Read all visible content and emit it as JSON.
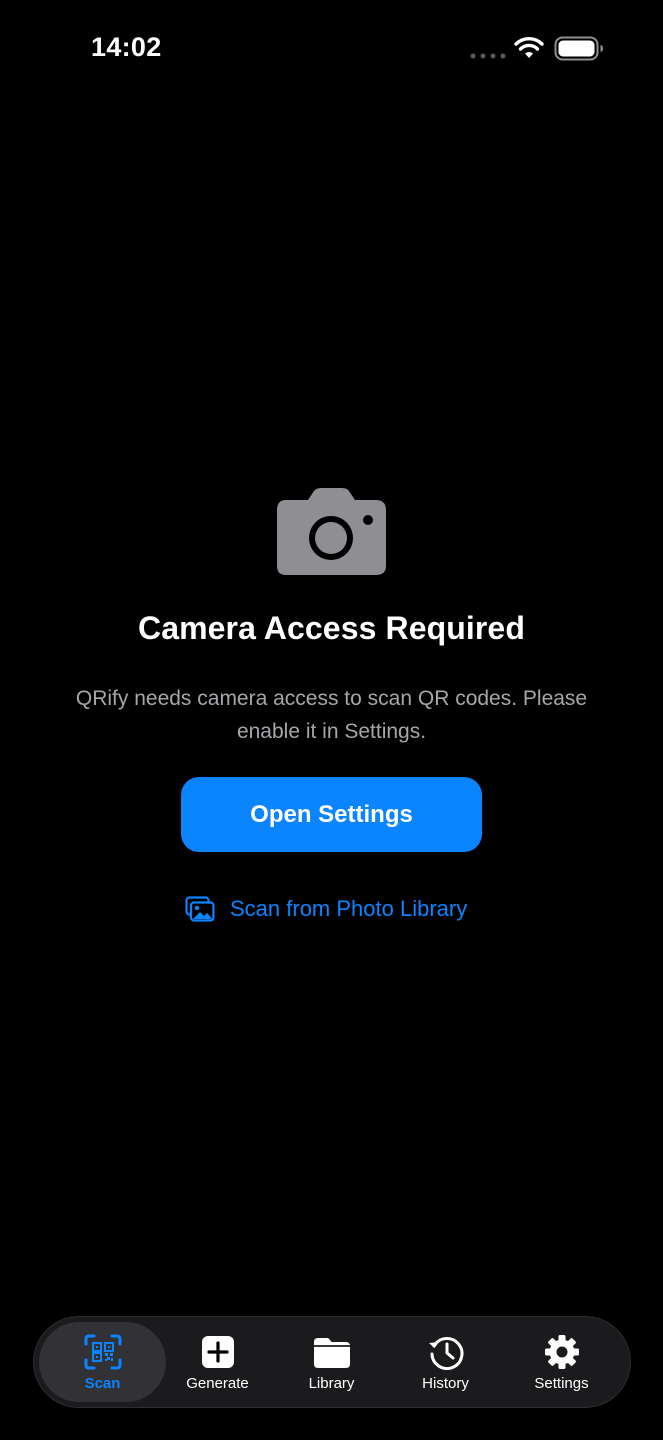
{
  "status_bar": {
    "time": "14:02"
  },
  "permission": {
    "title": "Camera Access Required",
    "message": "QRify needs camera access to scan QR codes. Please enable it in Settings.",
    "primary_button": "Open Settings",
    "secondary_link": "Scan from Photo Library"
  },
  "tab_bar": {
    "active": "Scan",
    "tabs": [
      {
        "label": "Scan",
        "icon": "qr-scan-icon"
      },
      {
        "label": "Generate",
        "icon": "plus-square-icon"
      },
      {
        "label": "Library",
        "icon": "folder-icon"
      },
      {
        "label": "History",
        "icon": "history-clock-icon"
      },
      {
        "label": "Settings",
        "icon": "gear-icon"
      }
    ]
  },
  "colors": {
    "background": "#000000",
    "accent": "#0a84ff",
    "secondary_text": "#a6a6ab",
    "icon_gray": "#8e8e93",
    "tab_bar_bg": "#1b1b1d"
  }
}
